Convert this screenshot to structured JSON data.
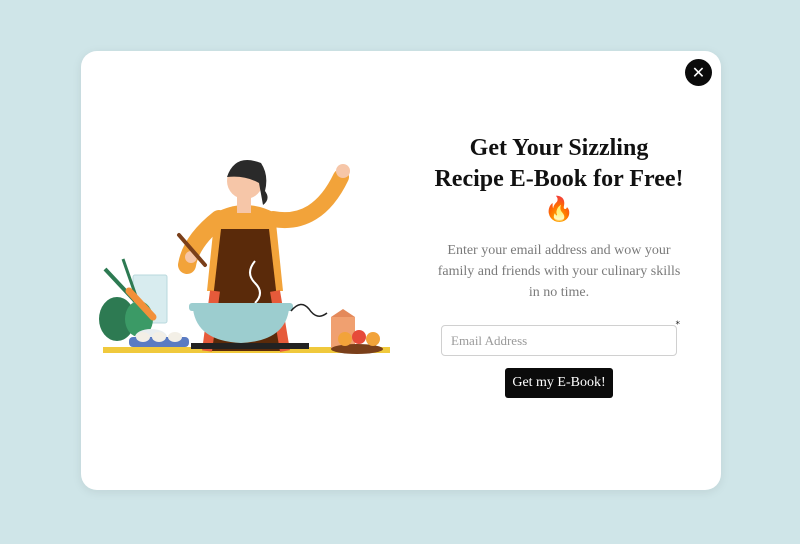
{
  "modal": {
    "close_icon": "close-icon",
    "headline": "Get Your Sizzling Recipe E-Book for Free!🔥",
    "subtext": "Enter your email address and wow your family and friends with your culinary skills in no time.",
    "email": {
      "placeholder": "Email Address",
      "value": "",
      "required_mark": "*"
    },
    "cta_label": "Get my E-Book!",
    "illustration": "woman-cooking-illustration"
  },
  "colors": {
    "page_background": "#cfe5e8",
    "modal_background": "#ffffff",
    "button_background": "#0b0b0b",
    "accent_orange": "#f2a33a",
    "apron_brown": "#5a2a0a",
    "pot_teal": "#9ccdcf",
    "counter_yellow": "#f0c93c"
  }
}
